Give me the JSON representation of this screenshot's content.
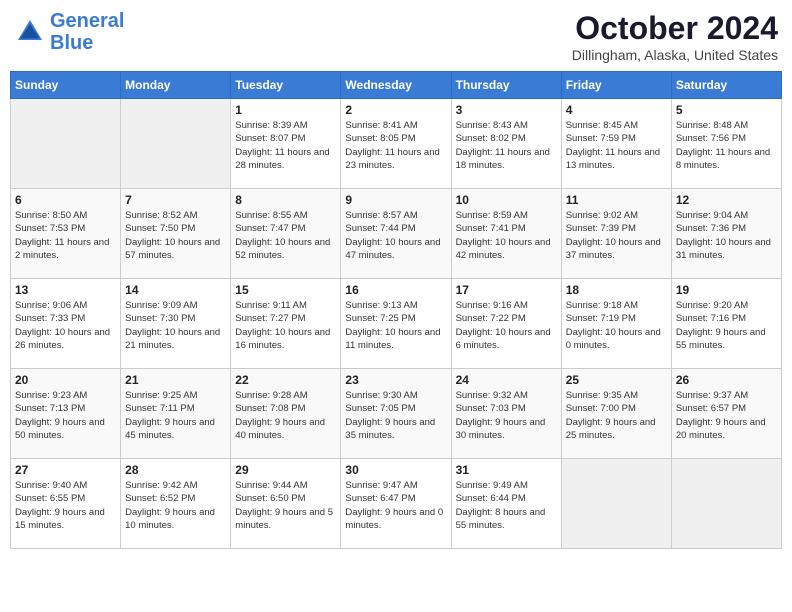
{
  "header": {
    "logo_line1": "General",
    "logo_line2": "Blue",
    "month": "October 2024",
    "location": "Dillingham, Alaska, United States"
  },
  "weekdays": [
    "Sunday",
    "Monday",
    "Tuesday",
    "Wednesday",
    "Thursday",
    "Friday",
    "Saturday"
  ],
  "weeks": [
    [
      {
        "day": "",
        "sunrise": "",
        "sunset": "",
        "daylight": ""
      },
      {
        "day": "",
        "sunrise": "",
        "sunset": "",
        "daylight": ""
      },
      {
        "day": "1",
        "sunrise": "Sunrise: 8:39 AM",
        "sunset": "Sunset: 8:07 PM",
        "daylight": "Daylight: 11 hours and 28 minutes."
      },
      {
        "day": "2",
        "sunrise": "Sunrise: 8:41 AM",
        "sunset": "Sunset: 8:05 PM",
        "daylight": "Daylight: 11 hours and 23 minutes."
      },
      {
        "day": "3",
        "sunrise": "Sunrise: 8:43 AM",
        "sunset": "Sunset: 8:02 PM",
        "daylight": "Daylight: 11 hours and 18 minutes."
      },
      {
        "day": "4",
        "sunrise": "Sunrise: 8:45 AM",
        "sunset": "Sunset: 7:59 PM",
        "daylight": "Daylight: 11 hours and 13 minutes."
      },
      {
        "day": "5",
        "sunrise": "Sunrise: 8:48 AM",
        "sunset": "Sunset: 7:56 PM",
        "daylight": "Daylight: 11 hours and 8 minutes."
      }
    ],
    [
      {
        "day": "6",
        "sunrise": "Sunrise: 8:50 AM",
        "sunset": "Sunset: 7:53 PM",
        "daylight": "Daylight: 11 hours and 2 minutes."
      },
      {
        "day": "7",
        "sunrise": "Sunrise: 8:52 AM",
        "sunset": "Sunset: 7:50 PM",
        "daylight": "Daylight: 10 hours and 57 minutes."
      },
      {
        "day": "8",
        "sunrise": "Sunrise: 8:55 AM",
        "sunset": "Sunset: 7:47 PM",
        "daylight": "Daylight: 10 hours and 52 minutes."
      },
      {
        "day": "9",
        "sunrise": "Sunrise: 8:57 AM",
        "sunset": "Sunset: 7:44 PM",
        "daylight": "Daylight: 10 hours and 47 minutes."
      },
      {
        "day": "10",
        "sunrise": "Sunrise: 8:59 AM",
        "sunset": "Sunset: 7:41 PM",
        "daylight": "Daylight: 10 hours and 42 minutes."
      },
      {
        "day": "11",
        "sunrise": "Sunrise: 9:02 AM",
        "sunset": "Sunset: 7:39 PM",
        "daylight": "Daylight: 10 hours and 37 minutes."
      },
      {
        "day": "12",
        "sunrise": "Sunrise: 9:04 AM",
        "sunset": "Sunset: 7:36 PM",
        "daylight": "Daylight: 10 hours and 31 minutes."
      }
    ],
    [
      {
        "day": "13",
        "sunrise": "Sunrise: 9:06 AM",
        "sunset": "Sunset: 7:33 PM",
        "daylight": "Daylight: 10 hours and 26 minutes."
      },
      {
        "day": "14",
        "sunrise": "Sunrise: 9:09 AM",
        "sunset": "Sunset: 7:30 PM",
        "daylight": "Daylight: 10 hours and 21 minutes."
      },
      {
        "day": "15",
        "sunrise": "Sunrise: 9:11 AM",
        "sunset": "Sunset: 7:27 PM",
        "daylight": "Daylight: 10 hours and 16 minutes."
      },
      {
        "day": "16",
        "sunrise": "Sunrise: 9:13 AM",
        "sunset": "Sunset: 7:25 PM",
        "daylight": "Daylight: 10 hours and 11 minutes."
      },
      {
        "day": "17",
        "sunrise": "Sunrise: 9:16 AM",
        "sunset": "Sunset: 7:22 PM",
        "daylight": "Daylight: 10 hours and 6 minutes."
      },
      {
        "day": "18",
        "sunrise": "Sunrise: 9:18 AM",
        "sunset": "Sunset: 7:19 PM",
        "daylight": "Daylight: 10 hours and 0 minutes."
      },
      {
        "day": "19",
        "sunrise": "Sunrise: 9:20 AM",
        "sunset": "Sunset: 7:16 PM",
        "daylight": "Daylight: 9 hours and 55 minutes."
      }
    ],
    [
      {
        "day": "20",
        "sunrise": "Sunrise: 9:23 AM",
        "sunset": "Sunset: 7:13 PM",
        "daylight": "Daylight: 9 hours and 50 minutes."
      },
      {
        "day": "21",
        "sunrise": "Sunrise: 9:25 AM",
        "sunset": "Sunset: 7:11 PM",
        "daylight": "Daylight: 9 hours and 45 minutes."
      },
      {
        "day": "22",
        "sunrise": "Sunrise: 9:28 AM",
        "sunset": "Sunset: 7:08 PM",
        "daylight": "Daylight: 9 hours and 40 minutes."
      },
      {
        "day": "23",
        "sunrise": "Sunrise: 9:30 AM",
        "sunset": "Sunset: 7:05 PM",
        "daylight": "Daylight: 9 hours and 35 minutes."
      },
      {
        "day": "24",
        "sunrise": "Sunrise: 9:32 AM",
        "sunset": "Sunset: 7:03 PM",
        "daylight": "Daylight: 9 hours and 30 minutes."
      },
      {
        "day": "25",
        "sunrise": "Sunrise: 9:35 AM",
        "sunset": "Sunset: 7:00 PM",
        "daylight": "Daylight: 9 hours and 25 minutes."
      },
      {
        "day": "26",
        "sunrise": "Sunrise: 9:37 AM",
        "sunset": "Sunset: 6:57 PM",
        "daylight": "Daylight: 9 hours and 20 minutes."
      }
    ],
    [
      {
        "day": "27",
        "sunrise": "Sunrise: 9:40 AM",
        "sunset": "Sunset: 6:55 PM",
        "daylight": "Daylight: 9 hours and 15 minutes."
      },
      {
        "day": "28",
        "sunrise": "Sunrise: 9:42 AM",
        "sunset": "Sunset: 6:52 PM",
        "daylight": "Daylight: 9 hours and 10 minutes."
      },
      {
        "day": "29",
        "sunrise": "Sunrise: 9:44 AM",
        "sunset": "Sunset: 6:50 PM",
        "daylight": "Daylight: 9 hours and 5 minutes."
      },
      {
        "day": "30",
        "sunrise": "Sunrise: 9:47 AM",
        "sunset": "Sunset: 6:47 PM",
        "daylight": "Daylight: 9 hours and 0 minutes."
      },
      {
        "day": "31",
        "sunrise": "Sunrise: 9:49 AM",
        "sunset": "Sunset: 6:44 PM",
        "daylight": "Daylight: 8 hours and 55 minutes."
      },
      {
        "day": "",
        "sunrise": "",
        "sunset": "",
        "daylight": ""
      },
      {
        "day": "",
        "sunrise": "",
        "sunset": "",
        "daylight": ""
      }
    ]
  ]
}
